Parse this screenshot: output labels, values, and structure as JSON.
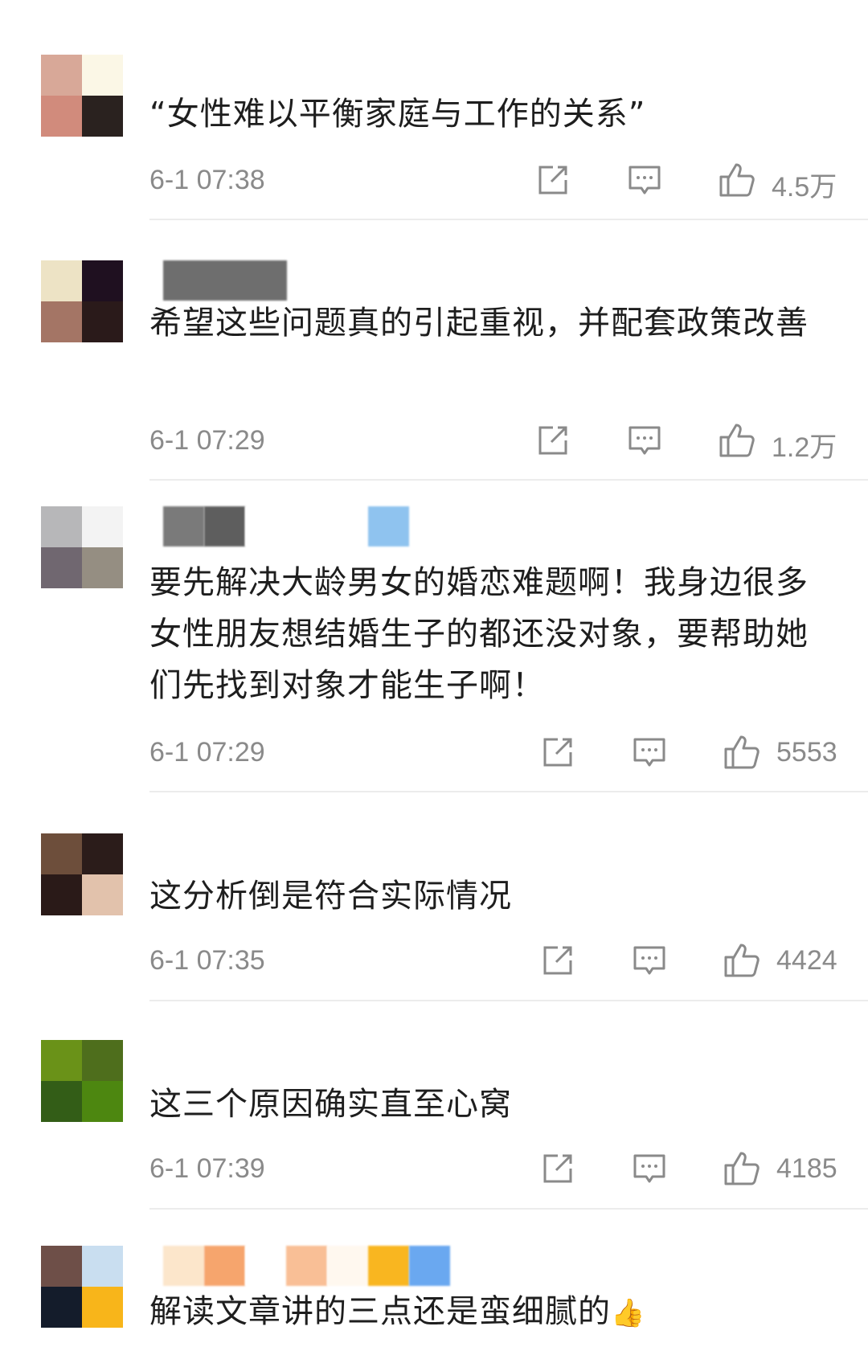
{
  "comments": [
    {
      "text": "“女性难以平衡家庭与工作的关系”",
      "time": "6-1 07:38",
      "likes": "4.5万",
      "avatar_colors": [
        "#d8a898",
        "#fbf7e6",
        "#d18b7c",
        "#2a221f"
      ],
      "name_blur_colors": []
    },
    {
      "text": "希望这些问题真的引起重视，并配套政策改善",
      "time": "6-1 07:29",
      "likes": "1.2万",
      "avatar_colors": [
        "#ede3c5",
        "#1f1020",
        "#a47565",
        "#2a1a1a"
      ],
      "name_blur_colors": [
        "#6e6e6e"
      ]
    },
    {
      "text": "要先解决大龄男女的婚恋难题啊！我身边很多女性朋友想结婚生子的都还没对象，要帮助她们先找到对象才能生子啊！",
      "time": "6-1 07:29",
      "likes": "5553",
      "avatar_colors": [
        "#b7b7b9",
        "#f3f3f3",
        "#706770",
        "#958e82"
      ],
      "name_blur_colors": [
        "#7a7a7a",
        "#5e5e5e",
        "#ffffff",
        "#8fc3ef"
      ]
    },
    {
      "text": "这分析倒是符合实际情况",
      "time": "6-1 07:35",
      "likes": "4424",
      "avatar_colors": [
        "#6d4e3b",
        "#2b1c1a",
        "#2a1a18",
        "#e2c2ac"
      ],
      "name_blur_colors": []
    },
    {
      "text": "这三个原因确实直至心窝",
      "time": "6-1 07:39",
      "likes": "4185",
      "avatar_colors": [
        "#6a9218",
        "#4e6e1c",
        "#335d17",
        "#4d8710"
      ],
      "name_blur_colors": []
    },
    {
      "text": "解读文章讲的三点还是蛮细腻的",
      "emoji": "👍",
      "avatar_colors": [
        "#6e4f48",
        "#c9def0",
        "#141c2b",
        "#f8b51a"
      ],
      "name_blur_colors": [
        "#fce6cb",
        "#f6a56d",
        "#ffffff",
        "#f9bf96",
        "#fff8ef",
        "#f9b620",
        "#6aa8f0"
      ]
    }
  ],
  "icons": {
    "share": "share-external-icon",
    "reply": "comment-bubble-icon",
    "like": "thumbs-up-icon"
  },
  "colors": {
    "meta_gray": "#8a8a8a",
    "text": "#1e1e1e",
    "divider": "#ececec"
  }
}
